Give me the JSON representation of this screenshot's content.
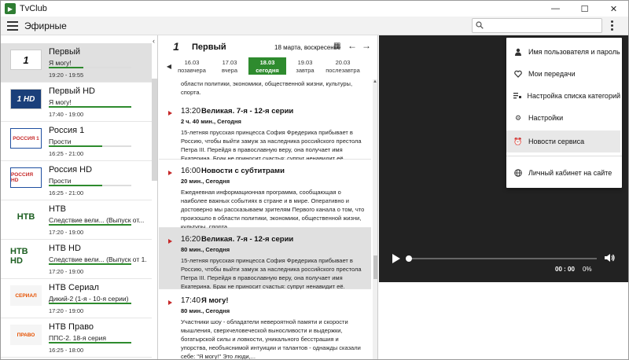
{
  "window": {
    "title": "TvClub",
    "minimize": "—",
    "maximize": "☐",
    "close": "✕"
  },
  "appbar": {
    "section": "Эфирные",
    "search_placeholder": ""
  },
  "colors": {
    "accent": "#2e8b2e",
    "live_marker": "#c62828",
    "player_bg": "#222222",
    "selected_row": "#e0e0e0"
  },
  "channels": [
    {
      "name": "Первый",
      "show": "Я могу!",
      "time": "19:20 - 19:55",
      "progress": 0.42,
      "logo": "1"
    },
    {
      "name": "Первый HD",
      "show": "Я могу!",
      "time": "17:40 - 19:00",
      "progress": 1.0,
      "logo": "1 HD"
    },
    {
      "name": "Россия 1",
      "show": "Прости",
      "time": "16:25 - 21:00",
      "progress": 0.65,
      "logo": "РОССИЯ 1"
    },
    {
      "name": "Россия HD",
      "show": "Прости",
      "time": "16:25 - 21:00",
      "progress": 0.65,
      "logo": "РОССИЯ HD"
    },
    {
      "name": "НТВ",
      "show": "Следствие вели... (Выпуск от...",
      "time": "17:20 - 19:00",
      "progress": 1.0,
      "logo": "НТВ"
    },
    {
      "name": "НТВ HD",
      "show": "Следствие вели... (Выпуск от 1...",
      "time": "17:20 - 19:00",
      "progress": 1.0,
      "logo": "НТВ HD"
    },
    {
      "name": "НТВ Сериал",
      "show": "Дикий-2 (1-я - 10-я серии)",
      "time": "17:20 - 19:00",
      "progress": 1.0,
      "logo": "СЕРИАЛ"
    },
    {
      "name": "НТВ Право",
      "show": "ППС-2. 18-я серия",
      "time": "16:25 - 18:00",
      "progress": 1.0,
      "logo": "ПРАВО"
    }
  ],
  "epg": {
    "channel": "Первый",
    "date": "18 марта, воскресенье",
    "days": [
      {
        "date": "16.03",
        "label": "позавчера"
      },
      {
        "date": "17.03",
        "label": "вчера"
      },
      {
        "date": "18.03",
        "label": "сегодня"
      },
      {
        "date": "19.03",
        "label": "завтра"
      },
      {
        "date": "20.03",
        "label": "послезавтра"
      }
    ],
    "top_desc": "области политики, экономики, общественной жизни, культуры, спорта.",
    "programs": [
      {
        "time": "13:20",
        "title": "Великая. 7-я - 12-я серии",
        "duration": "2 ч. 40 мин., Сегодня",
        "desc": "15-летняя прусская принцесса София Фредерика прибывает в Россию, чтобы выйти замуж за наследника российского престола Петра III. Перейдя в православную веру, она получает имя Екатерина. Брак не приносит счастья: супруг ненавидит её."
      },
      {
        "time": "16:00",
        "title": "Новости с субтитрами",
        "duration": "20 мин., Сегодня",
        "desc": "Ежедневная информационная программа, сообщающая о наиболее важных событиях в стране и в мире. Оперативно и достоверно мы рассказываем зрителям Первого канала о том, что произошло в области политики, экономики, общественной жизни, культуры, спорта."
      },
      {
        "time": "16:20",
        "title": "Великая. 7-я - 12-я серии",
        "duration": "80 мин., Сегодня",
        "desc": "15-летняя прусская принцесса София Фредерика прибывает в Россию, чтобы выйти замуж за наследника российского престола Петра III. Перейдя в православную веру, она получает имя Екатерина. Брак не приносит счастья: супруг ненавидит её."
      },
      {
        "time": "17:40",
        "title": "Я могу!",
        "duration": "80 мин., Сегодня",
        "desc": "Участники шоу - обладатели невероятной памяти и скорости мышления, сверхчеловеческой выносливости и выдержки, богатырской силы и ловкости, уникального бесстрашия и упорства, необъяснимой интуиции и талантов - однажды сказали себе: \"Я могу!\" Это люди,..."
      }
    ]
  },
  "player": {
    "time": "00 : 00",
    "percent": "0%",
    "position": 0.0
  },
  "menu": {
    "items": [
      {
        "label": "Имя пользователя и пароль",
        "icon": "person-icon"
      },
      {
        "label": "Мои передачи",
        "icon": "heart-icon"
      },
      {
        "label": "Настройка списка категорий",
        "icon": "list-settings-icon"
      },
      {
        "label": "Настройки",
        "icon": "gear-icon"
      },
      {
        "label": "Новости сервиса",
        "icon": "alarm-icon"
      },
      {
        "label": "Личный кабинет на сайте",
        "icon": "globe-icon"
      }
    ]
  }
}
